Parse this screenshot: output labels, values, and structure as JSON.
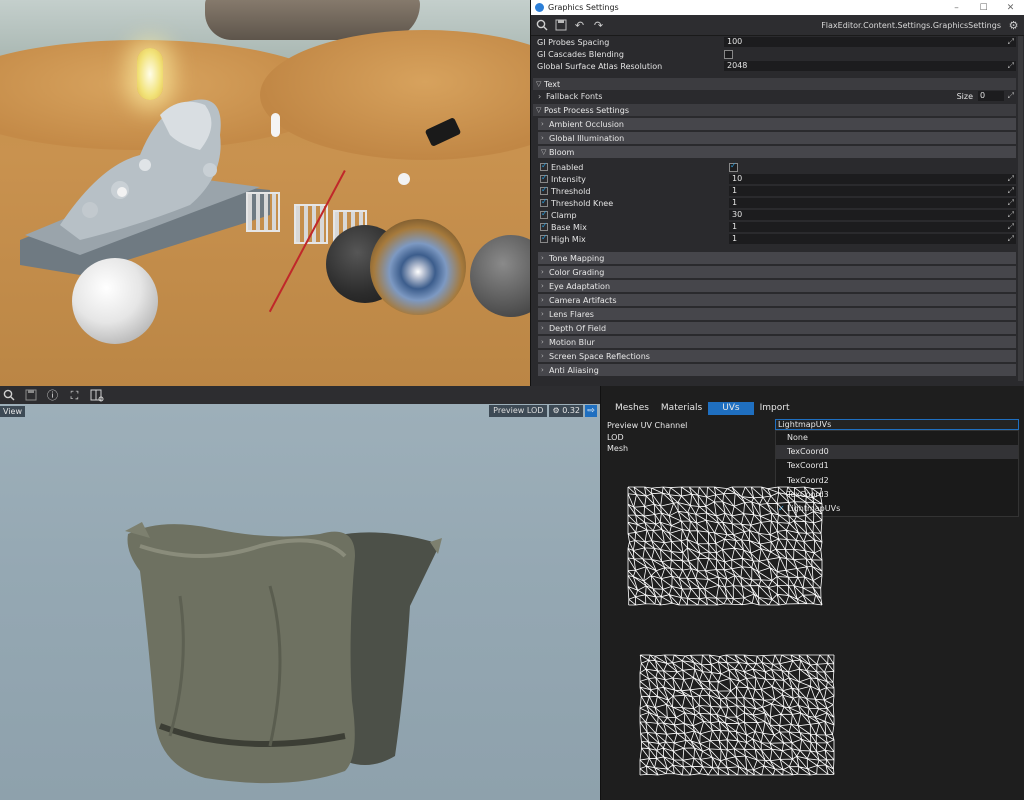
{
  "window": {
    "title": "Graphics Settings",
    "path": "FlaxEditor.Content.Settings.GraphicsSettings",
    "controls": [
      "–",
      "☐",
      "✕"
    ]
  },
  "global_rows": [
    {
      "label": "GI Probes Spacing",
      "value": "100",
      "type": "number"
    },
    {
      "label": "GI Cascades Blending",
      "value": "",
      "type": "check",
      "checked": false
    },
    {
      "label": "Global Surface Atlas Resolution",
      "value": "2048",
      "type": "number"
    }
  ],
  "text_section": {
    "title": "Text",
    "fallback_label": "Fallback Fonts",
    "size_label": "Size",
    "size_value": "0"
  },
  "post_process": {
    "title": "Post Process Settings",
    "ambient_occlusion": "Ambient Occlusion",
    "global_illumination": "Global Illumination",
    "bloom": {
      "title": "Bloom",
      "rows": [
        {
          "label": "Enabled",
          "value": "",
          "type": "check",
          "checked": true
        },
        {
          "label": "Intensity",
          "value": "10",
          "type": "number"
        },
        {
          "label": "Threshold",
          "value": "1",
          "type": "number"
        },
        {
          "label": "Threshold Knee",
          "value": "1",
          "type": "number"
        },
        {
          "label": "Clamp",
          "value": "30",
          "type": "number"
        },
        {
          "label": "Base Mix",
          "value": "1",
          "type": "number"
        },
        {
          "label": "High Mix",
          "value": "1",
          "type": "number"
        }
      ]
    },
    "more_sections": [
      "Tone Mapping",
      "Color Grading",
      "Eye Adaptation",
      "Camera Artifacts",
      "Lens Flares",
      "Depth Of Field",
      "Motion Blur",
      "Screen Space Reflections",
      "Anti Aliasing"
    ]
  },
  "preview": {
    "view_label": "View",
    "lod_label": "Preview LOD",
    "lod_value": "0.32"
  },
  "uv_panel": {
    "tabs": [
      "Meshes",
      "Materials",
      "UVs",
      "Import"
    ],
    "active_tab": "UVs",
    "labels": {
      "channel": "Preview UV Channel",
      "lod": "LOD",
      "mesh": "Mesh"
    },
    "selected": "LightmapUVs",
    "options": [
      "None",
      "TexCoord0",
      "TexCoord1",
      "TexCoord2",
      "TexCoord3",
      "LightmapUVs"
    ],
    "hover_option": "TexCoord0"
  },
  "colors": {
    "accent": "#1f6fc0",
    "check": "#2c9bd8",
    "panel": "#2a2a2d",
    "laser": "#c0282a"
  },
  "icons": [
    "search-icon",
    "save-icon",
    "undo-icon",
    "redo-icon",
    "settings-icon",
    "info-icon",
    "fit-icon",
    "book-search-icon",
    "arrow-right-icon"
  ]
}
